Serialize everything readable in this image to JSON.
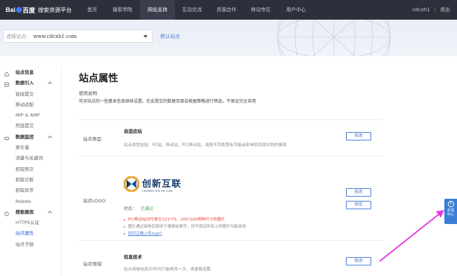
{
  "topnav": {
    "logo_text": "Bai",
    "logo_suffix": "百度",
    "product": "搜索资源平台",
    "items": [
      {
        "label": "首页",
        "width": 36,
        "active": false
      },
      {
        "label": "搜索学院",
        "width": 50,
        "active": false
      },
      {
        "label": "网站支持",
        "width": 50,
        "active": true
      },
      {
        "label": "互动交流",
        "width": 48,
        "active": false
      },
      {
        "label": "资源合作",
        "width": 50,
        "active": false
      },
      {
        "label": "移动专区",
        "width": 48,
        "active": false
      },
      {
        "label": "用户中心",
        "width": 52,
        "active": false
      }
    ],
    "username": "cdcxh1",
    "logout": "退出"
  },
  "site_bar": {
    "label": "选择站点:",
    "value": "www.cdcxh1.com",
    "default_link": "默认站点"
  },
  "sidebar": {
    "items": [
      {
        "label": "站点信息",
        "type": "head",
        "icon": "home-icon"
      },
      {
        "label": "数据引入",
        "type": "head",
        "icon": "data-import-icon",
        "chevron": true
      },
      {
        "label": "链接提交",
        "type": "sub"
      },
      {
        "label": "移动适配",
        "type": "sub"
      },
      {
        "label": "MIP & AMP",
        "type": "sub"
      },
      {
        "label": "死链提交",
        "type": "sub"
      },
      {
        "label": "数据监控",
        "type": "head",
        "icon": "monitor-icon",
        "chevron": true
      },
      {
        "label": "索引量",
        "type": "sub"
      },
      {
        "label": "流量与关键词",
        "type": "sub"
      },
      {
        "label": "抓取频次",
        "type": "sub"
      },
      {
        "label": "抓取诊断",
        "type": "sub"
      },
      {
        "label": "抓取异常",
        "type": "sub"
      },
      {
        "label": "Robots",
        "type": "sub"
      },
      {
        "label": "搜索展现",
        "type": "head",
        "icon": "display-icon",
        "chevron": true
      },
      {
        "label": "HTTPS认证",
        "type": "sub"
      },
      {
        "label": "站点属性",
        "type": "sub",
        "active": true
      },
      {
        "label": "站点子链",
        "type": "sub"
      }
    ]
  },
  "main": {
    "title": "站点属性",
    "usage_title": "使用说明",
    "usage_text": "可对站点的一些基本信息继续设置。在此提交的数据百度会根据策略进行筛选，不保证完全采用",
    "type_row": {
      "label": "站点类型:",
      "title": "自适应站",
      "desc": "站点类型包括：PC站、移动站、PC/移动站，选择不同类型有可能会影响到百度对你的展现",
      "button": "修改"
    },
    "logo_row": {
      "label": "站点LOGO:",
      "logo_cn": "创新互联",
      "logo_en": "CHUANG XIN HU LIAN",
      "status_label": "状态：",
      "status_value": "已通过",
      "button_edit": "修改",
      "button_preview": "预览",
      "notes": [
        {
          "text": "PC/移动站均可提交121*75、200*200两种尺寸的图片",
          "style": "red"
        },
        {
          "text": "图片通过审核后将用于搜索结果页，但不保证所有上传图片均能采用",
          "style": "grey"
        },
        {
          "text": "如何正确上传logo?",
          "style": "link"
        }
      ]
    },
    "domain_row": {
      "label": "站点领域:",
      "title": "信息技术",
      "desc": "站点领域信息30天内只能修改一次，请谨慎设置。",
      "button": "修改"
    }
  },
  "feedback": {
    "icon": "?",
    "label": "反馈\n中心"
  },
  "colors": {
    "nav_bg": "#2d2f3b",
    "accent": "#4a7fd6",
    "ok": "#3aa64b",
    "warn": "#e1453a",
    "annotation_arrow": "#e23be0"
  }
}
